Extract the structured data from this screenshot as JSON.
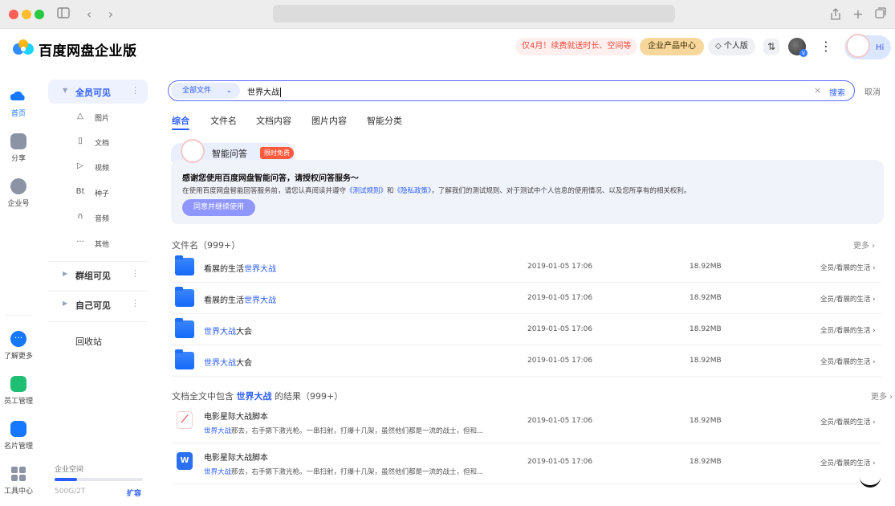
{
  "browser": {
    "controls": [
      "close",
      "minimize",
      "zoom"
    ],
    "icons": [
      "sidebar-toggle-icon",
      "back-icon",
      "forward-icon",
      "share-icon",
      "new-tab-icon",
      "tabs-overview-icon"
    ]
  },
  "header": {
    "brand": "百度网盘企业版",
    "promo": "仅4月！续费就送时长、空间等",
    "product_center": "企业产品中心",
    "personal_edition": "◇ 个人版",
    "transfer_icon": "⇅",
    "more_icon": "⋮",
    "greeting": "Hi"
  },
  "rail": {
    "items": [
      {
        "label": "首页",
        "icon": "home-icon"
      },
      {
        "label": "分享",
        "icon": "share-icon"
      },
      {
        "label": "企业号",
        "icon": "enterprise-icon"
      },
      {
        "label": "了解更多",
        "icon": "more-info-icon"
      },
      {
        "label": "员工管理",
        "icon": "staff-icon"
      },
      {
        "label": "名片管理",
        "icon": "card-icon"
      },
      {
        "label": "工具中心",
        "icon": "tools-icon"
      }
    ]
  },
  "nav": {
    "groups": [
      {
        "label": "全员可见",
        "expanded": true
      },
      {
        "label": "群组可见",
        "expanded": false
      },
      {
        "label": "自己可见",
        "expanded": false
      }
    ],
    "subitems": [
      {
        "label": "图片",
        "icon": "△"
      },
      {
        "label": "文档",
        "icon": "▯"
      },
      {
        "label": "视频",
        "icon": "▷"
      },
      {
        "label": "种子",
        "icon": "Bt"
      },
      {
        "label": "音频",
        "icon": "∩"
      },
      {
        "label": "其他",
        "icon": "···"
      }
    ],
    "recycle": "回收站",
    "space": {
      "label": "企业空间",
      "usage": "500G/2T",
      "fraction": 0.25,
      "expand": "扩容"
    }
  },
  "search": {
    "scope": "全部文件",
    "query": "世界大战",
    "submit": "搜索",
    "cancel": "取消"
  },
  "tabs": [
    "综合",
    "文件名",
    "文档内容",
    "图片内容",
    "智能分类"
  ],
  "ai_card": {
    "title": "智能问答",
    "tag": "限时免费",
    "heading": "感谢您使用百度网盘智能问答，请授权问答服务～",
    "desc_before": "在使用百度网盘智能回答服务前，请您认真阅读并遵守",
    "link_rules": "《测试规则》",
    "desc_and": "和",
    "link_privacy": "《隐私政策》",
    "desc_after": "，了解我们的测试规则、对于测试中个人信息的使用情况、以及您所享有的相关权利。",
    "agree_button": "同意并继续使用"
  },
  "filename_section": {
    "title": "文件名（999+）",
    "more": "更多 ›",
    "rows": [
      {
        "name_prefix": "看展的生活",
        "name_hl": "世界大战",
        "name_suffix": "",
        "date": "2019-01-05 17:06",
        "size": "18.92MB",
        "path": "全员/看展的生活 ›"
      },
      {
        "name_prefix": "看展的生活",
        "name_hl": "世界大战",
        "name_suffix": "",
        "date": "2019-01-05 17:06",
        "size": "18.92MB",
        "path": "全员/看展的生活 ›"
      },
      {
        "name_prefix": "",
        "name_hl": "世界大战",
        "name_suffix": "大会",
        "date": "2019-01-05 17:06",
        "size": "18.92MB",
        "path": "全员/看展的生活 ›"
      },
      {
        "name_prefix": "",
        "name_hl": "世界大战",
        "name_suffix": "大会",
        "date": "2019-01-05 17:06",
        "size": "18.92MB",
        "path": "全员/看展的生活 ›"
      }
    ]
  },
  "content_section": {
    "title_prefix": "文档全文中包含 ",
    "title_hl": "世界大战",
    "title_suffix": " 的结果（999+）",
    "more": "更多 ›",
    "rows": [
      {
        "type": "pdf",
        "badge": "⟋",
        "name": "电影星际大战脚本",
        "snippet_hl": "世界大战",
        "snippet": "那去，右手摁下激光枪。一串扫射，打爆十几架，虽然他们都是一流的战士，但和...",
        "date": "2019-01-05 17:06",
        "size": "18.92MB",
        "path": "全员/看展的生活 ›"
      },
      {
        "type": "doc",
        "badge": "W",
        "name": "电影星际大战脚本",
        "snippet_hl": "世界大战",
        "snippet": "那去，右手摁下激光枪。一串扫射，打爆十几架，虽然他们都是一流的战士，但和...",
        "date": "2019-01-05 17:06",
        "size": "18.92MB",
        "path": "全员/看展的生活 ›"
      }
    ]
  },
  "colors": {
    "accent": "#2b5cff",
    "folder": "#1469f7",
    "promo_text": "#f04a3a",
    "pdf": "#f25a5a"
  }
}
